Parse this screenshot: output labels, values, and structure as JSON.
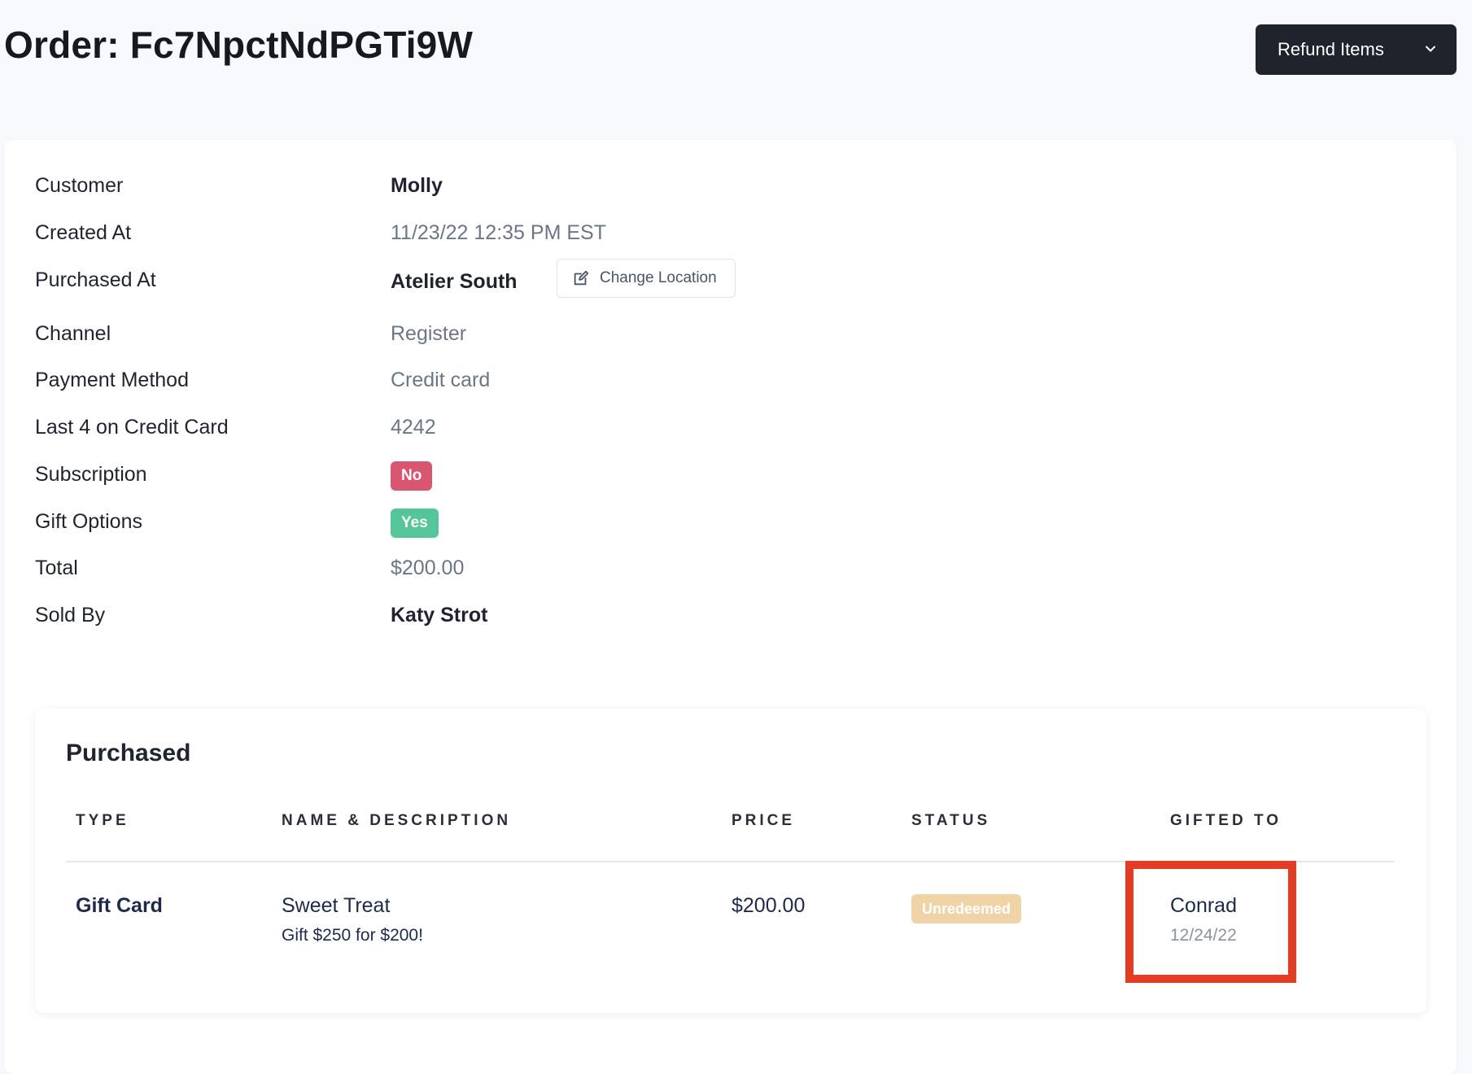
{
  "header": {
    "title": "Order: Fc7NpctNdPGTi9W",
    "refund_button": "Refund Items"
  },
  "details": {
    "customer": {
      "label": "Customer",
      "value": "Molly"
    },
    "created_at": {
      "label": "Created At",
      "value": "11/23/22 12:35 PM EST"
    },
    "purchased_at": {
      "label": "Purchased At",
      "value": "Atelier South",
      "action": "Change Location"
    },
    "channel": {
      "label": "Channel",
      "value": "Register"
    },
    "payment_method": {
      "label": "Payment Method",
      "value": "Credit card"
    },
    "last4": {
      "label": "Last 4 on Credit Card",
      "value": "4242"
    },
    "subscription": {
      "label": "Subscription",
      "value": "No"
    },
    "gift_options": {
      "label": "Gift Options",
      "value": "Yes"
    },
    "total": {
      "label": "Total",
      "value": "$200.00"
    },
    "sold_by": {
      "label": "Sold By",
      "value": "Katy Strot"
    }
  },
  "purchased": {
    "title": "Purchased",
    "columns": [
      "TYPE",
      "NAME & DESCRIPTION",
      "PRICE",
      "STATUS",
      "GIFTED TO"
    ],
    "rows": [
      {
        "type": "Gift Card",
        "name": "Sweet Treat",
        "description": "Gift $250 for $200!",
        "price": "$200.00",
        "status": "Unredeemed",
        "gifted_to": "Conrad",
        "gifted_date": "12/24/22"
      }
    ]
  },
  "colors": {
    "accent_dark": "#1f232c",
    "badge_no": "#d8566f",
    "badge_yes": "#55c69a",
    "badge_unredeemed": "#f1d3a8",
    "highlight": "#e53d25"
  }
}
